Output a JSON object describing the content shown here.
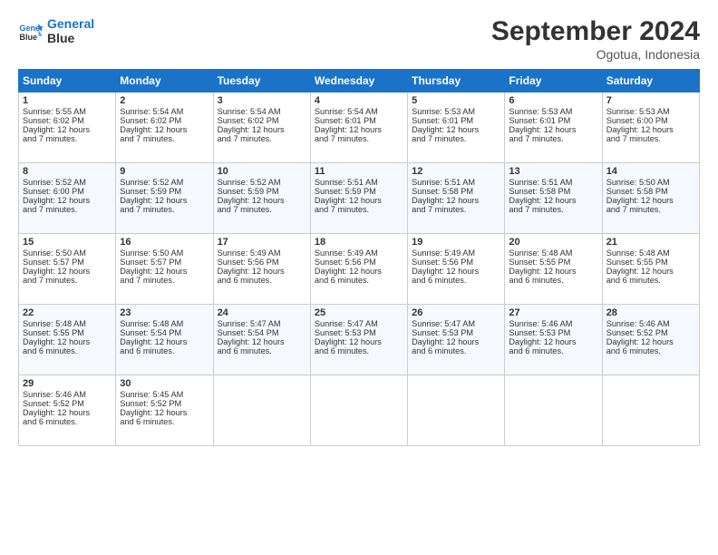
{
  "header": {
    "logo_line1": "General",
    "logo_line2": "Blue",
    "month": "September 2024",
    "location": "Ogotua, Indonesia"
  },
  "days_of_week": [
    "Sunday",
    "Monday",
    "Tuesday",
    "Wednesday",
    "Thursday",
    "Friday",
    "Saturday"
  ],
  "weeks": [
    [
      {
        "day": "1",
        "info": "Sunrise: 5:55 AM\nSunset: 6:02 PM\nDaylight: 12 hours\nand 7 minutes."
      },
      {
        "day": "2",
        "info": "Sunrise: 5:54 AM\nSunset: 6:02 PM\nDaylight: 12 hours\nand 7 minutes."
      },
      {
        "day": "3",
        "info": "Sunrise: 5:54 AM\nSunset: 6:02 PM\nDaylight: 12 hours\nand 7 minutes."
      },
      {
        "day": "4",
        "info": "Sunrise: 5:54 AM\nSunset: 6:01 PM\nDaylight: 12 hours\nand 7 minutes."
      },
      {
        "day": "5",
        "info": "Sunrise: 5:53 AM\nSunset: 6:01 PM\nDaylight: 12 hours\nand 7 minutes."
      },
      {
        "day": "6",
        "info": "Sunrise: 5:53 AM\nSunset: 6:01 PM\nDaylight: 12 hours\nand 7 minutes."
      },
      {
        "day": "7",
        "info": "Sunrise: 5:53 AM\nSunset: 6:00 PM\nDaylight: 12 hours\nand 7 minutes."
      }
    ],
    [
      {
        "day": "8",
        "info": "Sunrise: 5:52 AM\nSunset: 6:00 PM\nDaylight: 12 hours\nand 7 minutes."
      },
      {
        "day": "9",
        "info": "Sunrise: 5:52 AM\nSunset: 5:59 PM\nDaylight: 12 hours\nand 7 minutes."
      },
      {
        "day": "10",
        "info": "Sunrise: 5:52 AM\nSunset: 5:59 PM\nDaylight: 12 hours\nand 7 minutes."
      },
      {
        "day": "11",
        "info": "Sunrise: 5:51 AM\nSunset: 5:59 PM\nDaylight: 12 hours\nand 7 minutes."
      },
      {
        "day": "12",
        "info": "Sunrise: 5:51 AM\nSunset: 5:58 PM\nDaylight: 12 hours\nand 7 minutes."
      },
      {
        "day": "13",
        "info": "Sunrise: 5:51 AM\nSunset: 5:58 PM\nDaylight: 12 hours\nand 7 minutes."
      },
      {
        "day": "14",
        "info": "Sunrise: 5:50 AM\nSunset: 5:58 PM\nDaylight: 12 hours\nand 7 minutes."
      }
    ],
    [
      {
        "day": "15",
        "info": "Sunrise: 5:50 AM\nSunset: 5:57 PM\nDaylight: 12 hours\nand 7 minutes."
      },
      {
        "day": "16",
        "info": "Sunrise: 5:50 AM\nSunset: 5:57 PM\nDaylight: 12 hours\nand 7 minutes."
      },
      {
        "day": "17",
        "info": "Sunrise: 5:49 AM\nSunset: 5:56 PM\nDaylight: 12 hours\nand 6 minutes."
      },
      {
        "day": "18",
        "info": "Sunrise: 5:49 AM\nSunset: 5:56 PM\nDaylight: 12 hours\nand 6 minutes."
      },
      {
        "day": "19",
        "info": "Sunrise: 5:49 AM\nSunset: 5:56 PM\nDaylight: 12 hours\nand 6 minutes."
      },
      {
        "day": "20",
        "info": "Sunrise: 5:48 AM\nSunset: 5:55 PM\nDaylight: 12 hours\nand 6 minutes."
      },
      {
        "day": "21",
        "info": "Sunrise: 5:48 AM\nSunset: 5:55 PM\nDaylight: 12 hours\nand 6 minutes."
      }
    ],
    [
      {
        "day": "22",
        "info": "Sunrise: 5:48 AM\nSunset: 5:55 PM\nDaylight: 12 hours\nand 6 minutes."
      },
      {
        "day": "23",
        "info": "Sunrise: 5:48 AM\nSunset: 5:54 PM\nDaylight: 12 hours\nand 6 minutes."
      },
      {
        "day": "24",
        "info": "Sunrise: 5:47 AM\nSunset: 5:54 PM\nDaylight: 12 hours\nand 6 minutes."
      },
      {
        "day": "25",
        "info": "Sunrise: 5:47 AM\nSunset: 5:53 PM\nDaylight: 12 hours\nand 6 minutes."
      },
      {
        "day": "26",
        "info": "Sunrise: 5:47 AM\nSunset: 5:53 PM\nDaylight: 12 hours\nand 6 minutes."
      },
      {
        "day": "27",
        "info": "Sunrise: 5:46 AM\nSunset: 5:53 PM\nDaylight: 12 hours\nand 6 minutes."
      },
      {
        "day": "28",
        "info": "Sunrise: 5:46 AM\nSunset: 5:52 PM\nDaylight: 12 hours\nand 6 minutes."
      }
    ],
    [
      {
        "day": "29",
        "info": "Sunrise: 5:46 AM\nSunset: 5:52 PM\nDaylight: 12 hours\nand 6 minutes."
      },
      {
        "day": "30",
        "info": "Sunrise: 5:45 AM\nSunset: 5:52 PM\nDaylight: 12 hours\nand 6 minutes."
      },
      {
        "day": "",
        "info": ""
      },
      {
        "day": "",
        "info": ""
      },
      {
        "day": "",
        "info": ""
      },
      {
        "day": "",
        "info": ""
      },
      {
        "day": "",
        "info": ""
      }
    ]
  ]
}
